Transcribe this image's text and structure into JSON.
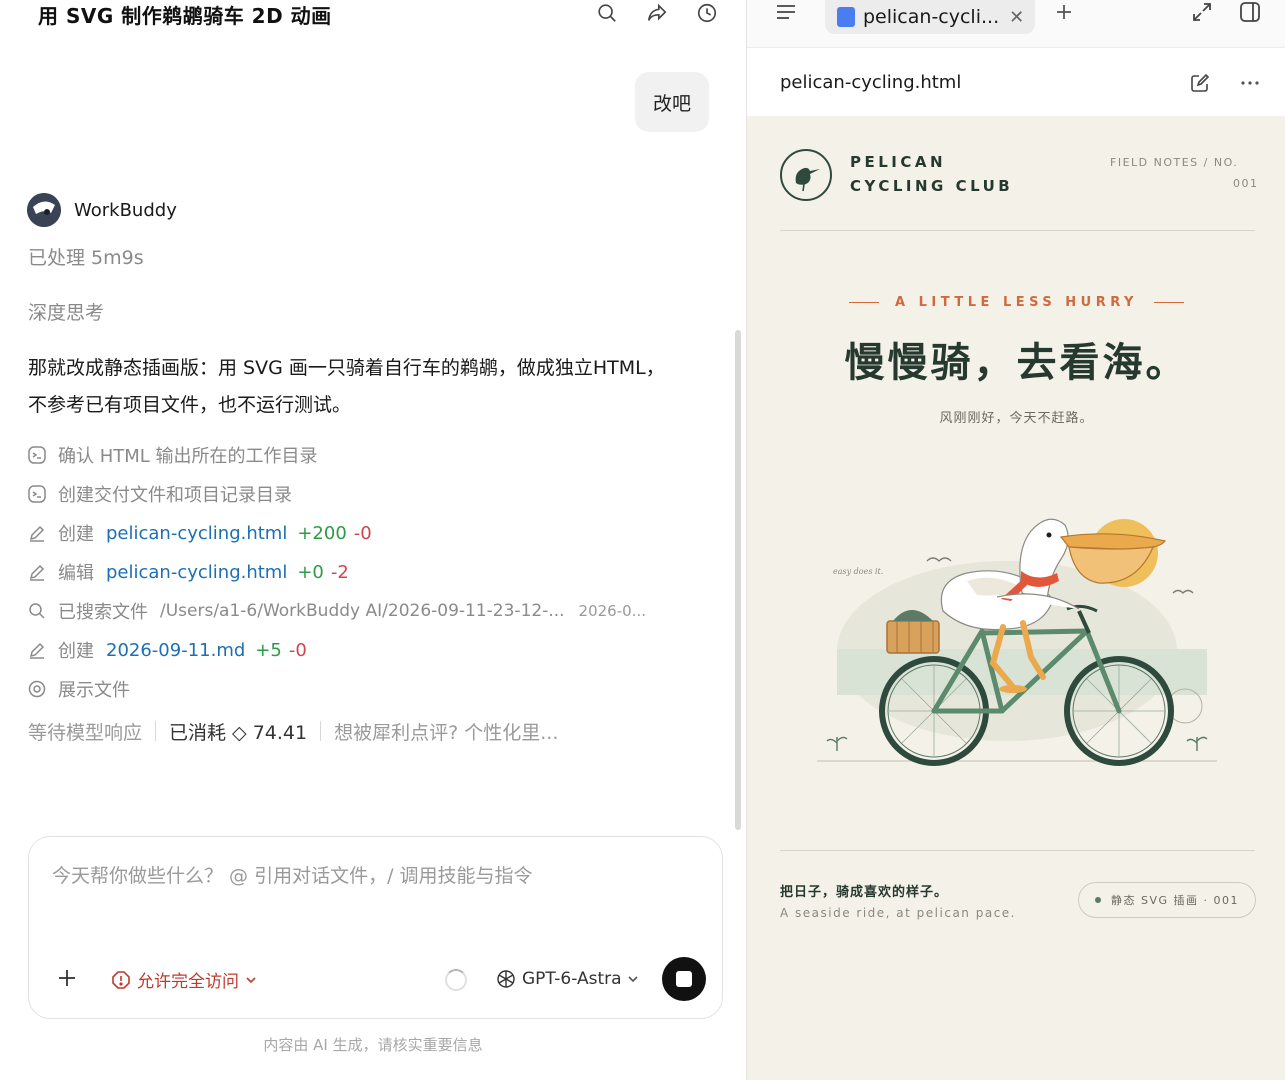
{
  "chat": {
    "title": "用 SVG 制作鹈鹕骑车 2D 动画",
    "user_message": "改吧",
    "agent_name": "WorkBuddy",
    "processed": "已处理 5m9s",
    "deep_think": "深度思考",
    "answer": "那就改成静态插画版：用 SVG 画一只骑着自行车的鹈鹕，做成独立HTML，不参考已有项目文件，也不运行测试。",
    "steps": [
      {
        "icon": "terminal-icon",
        "verb": "确认 HTML 输出所在的工作目录"
      },
      {
        "icon": "terminal-icon",
        "verb": "创建交付文件和项目记录目录"
      },
      {
        "icon": "pencil-icon",
        "verb": "创建",
        "file": "pelican-cycling.html",
        "add": "+200",
        "del": "-0"
      },
      {
        "icon": "pencil-icon",
        "verb": "编辑",
        "file": "pelican-cycling.html",
        "add": "+0",
        "del": "-2"
      },
      {
        "icon": "search-icon",
        "verb": "已搜索文件",
        "path": "/Users/a1-6/WorkBuddy AI/2026-09-11-23-12-...",
        "path2": "2026-0..."
      },
      {
        "icon": "pencil-icon",
        "verb": "创建",
        "file": "2026-09-11.md",
        "add": "+5",
        "del": "-0"
      },
      {
        "icon": "eye-icon",
        "verb": "展示文件"
      }
    ],
    "status": {
      "waiting": "等待模型响应",
      "consumed": "已消耗 ◇ 74.41",
      "hint": "想被犀利点评? 个性化里..."
    },
    "composer": {
      "placeholder": "今天帮你做些什么？ @ 引用对话文件，/ 调用技能与指令",
      "access_label": "允许完全访问",
      "model_label": "GPT-6-Astra"
    },
    "disclaimer": "内容由 AI 生成，请核实重要信息"
  },
  "preview": {
    "tab_label": "pelican-cycli...",
    "file_name": "pelican-cycling.html",
    "poster": {
      "brand_line1": "PELICAN",
      "brand_line2": "CYCLING CLUB",
      "field_notes": "FIELD NOTES  /  NO.",
      "issue_number": "001",
      "kicker": "A LITTLE LESS HURRY",
      "headline": "慢慢骑，去看海。",
      "subline": "风刚刚好，今天不赶路。",
      "scene_caption": "easy does it.",
      "footer_zh": "把日子，骑成喜欢的样子。",
      "footer_en": "A seaside ride, at pelican pace.",
      "badge": "静态 SVG 插画 · 001"
    }
  },
  "colors": {
    "link": "#1c6fb5",
    "add": "#2d9b46",
    "del": "#d0454c",
    "accent_orange": "#d06a3e",
    "poster_bg": "#f4f1e8",
    "forest": "#26392f"
  }
}
